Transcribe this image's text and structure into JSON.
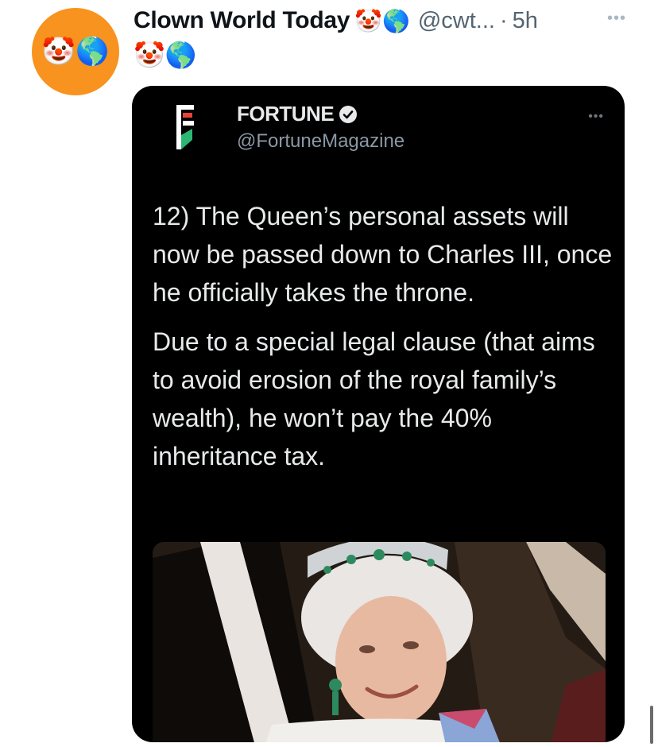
{
  "tweet": {
    "display_name": "Clown World Today",
    "name_emoji": "🤡🌎",
    "handle": "@cwt...",
    "separator": "·",
    "time": "5h",
    "more_label": "•••",
    "bio_emoji": "🤡🌎",
    "avatar_emoji": "🤡🌎"
  },
  "quoted": {
    "name": "FORTUNE",
    "handle": "@FortuneMagazine",
    "more_label": "•••",
    "paragraphs": [
      "12) The Queen’s personal assets will now be passed down to Charles III, once he officially takes the throne.",
      "Due to a special legal clause (that aims to avoid erosion of the royal family’s wealth), he won’t pay the 40% inheritance tax."
    ]
  },
  "colors": {
    "avatar_bg": "#f7931e",
    "card_bg": "#000000",
    "text_primary": "#0f1419",
    "text_secondary": "#536471"
  },
  "icons": {
    "verified": "verified-badge-icon",
    "more": "more-icon",
    "logo": "fortune-logo-icon"
  }
}
